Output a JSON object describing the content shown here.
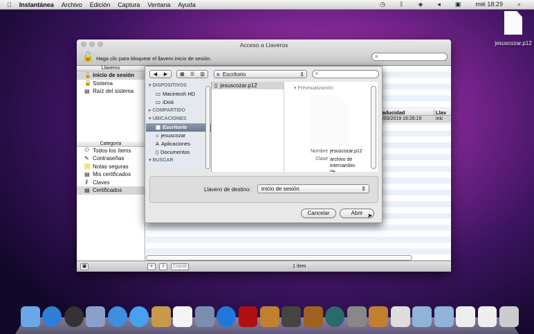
{
  "menubar": {
    "app": "Instantánea",
    "items": [
      "Archivo",
      "Edición",
      "Captura",
      "Ventana",
      "Ayuda"
    ],
    "clock": "mié 18:29"
  },
  "desktop": {
    "file": "jesuscozar.p12"
  },
  "keychain": {
    "title": "Acceso a Llaveros",
    "lock_text": "Haga clic para bloquear el llavero inicio de sesión.",
    "keychains_header": "Llaveros",
    "keychains": [
      "inicio de sesión",
      "Sistema",
      "Raíz del sistema"
    ],
    "category_header": "Categoría",
    "categories": [
      "Todos los ítems",
      "Contraseñas",
      "Notas seguras",
      "Mis certificados",
      "Claves",
      "Certificados"
    ],
    "columns": [
      "Caducidad",
      "Llav"
    ],
    "row": {
      "expires": "8/03/2019 16:26:19",
      "keychain": "inic"
    },
    "copy_label": "Copiar",
    "count": "1 ítem"
  },
  "sheet": {
    "location": "Escritorio",
    "sidebar": {
      "devices_header": "DISPOSITIVOS",
      "devices": [
        "Macintosh HD",
        "iDisk"
      ],
      "shared_header": "COMPARTIDO",
      "places_header": "UBICACIONES",
      "places": [
        "Escritorio",
        "jesuscozar",
        "Aplicaciones",
        "Documentos"
      ],
      "search_header": "BUSCAR"
    },
    "files": [
      "jesuscozar.p12"
    ],
    "preview": {
      "header": "Previsualización:",
      "name_label": "Nombre",
      "name": "jesuscozar.p12",
      "kind_label": "Clase",
      "kind": "archivo de intercambio de"
    },
    "dest_label": "Llavero de destino:",
    "dest_value": "inicio de sesión",
    "cancel": "Cancelar",
    "open": "Abrir"
  },
  "dock": {
    "icons": [
      "finder",
      "app-store",
      "dashboard",
      "mail",
      "safari",
      "ichat",
      "address-book",
      "ical",
      "iphoto-preview",
      "itunes",
      "photo-booth",
      "iphoto",
      "imovie",
      "garageband",
      "time-machine",
      "system-preferences",
      "keychain",
      "utility",
      "applications-folder",
      "documents-folder",
      "file",
      "preview",
      "trash"
    ]
  }
}
